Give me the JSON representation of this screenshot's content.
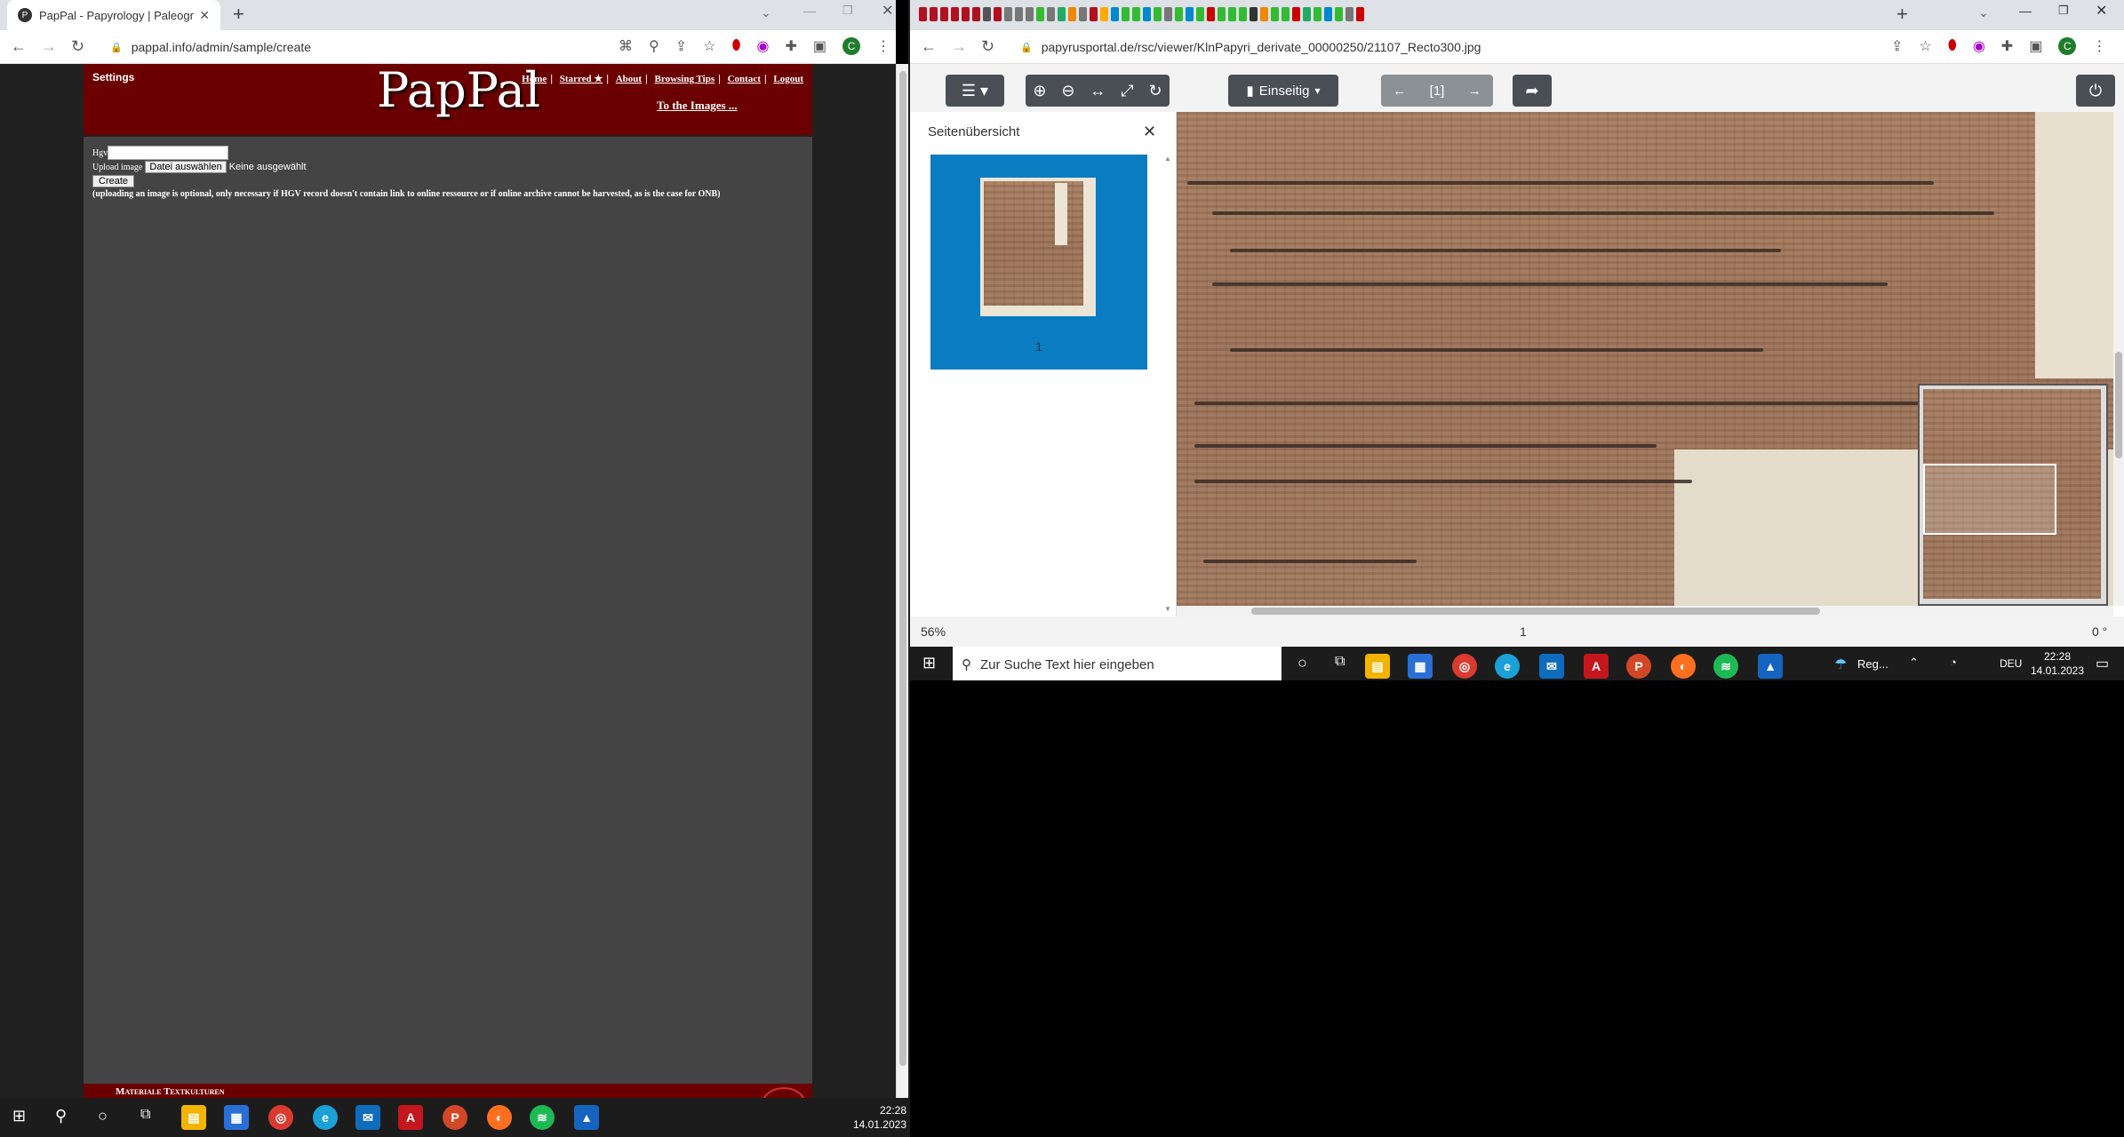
{
  "left_browser": {
    "tab_title": "PapPal - Papyrology | Paleograph",
    "url": "pappal.info/admin/sample/create"
  },
  "right_browser": {
    "url": "papyrusportal.de/rsc/viewer/KlnPapyri_derivate_00000250/21107_Recto300.jpg"
  },
  "pappal": {
    "settings": "Settings",
    "logo": "PapPal",
    "nav": [
      "Home",
      "Starred ★",
      "About",
      "Browsing Tips",
      "Contact",
      "Logout"
    ],
    "to_images": "To the Images ...",
    "hgv_label": "Hgv",
    "hgv_value": "",
    "upload_label": "Upload image",
    "file_button": "Datei auswählen",
    "file_status": "Keine ausgewählt",
    "create_button": "Create",
    "note": "(uploading an image is optional, only necessary if HGV record doesn't contain link to online ressource or if online archive cannot be harvested, as is the case for ONB)",
    "footer": "Materiale Textkulturen"
  },
  "viewer": {
    "mode": "Einseitig",
    "page_indicator": "[1]",
    "sidebar_title": "Seitenübersicht",
    "thumb_label": "1",
    "zoom": "56%",
    "page": "1",
    "rotation": "0 °"
  },
  "taskbar": {
    "search_placeholder": "Zur Suche Text hier eingeben",
    "left_time": "22:28",
    "left_date": "14.01.2023",
    "weather": "Reg...",
    "lang": "DEU",
    "right_time": "22:28",
    "right_date": "14.01.2023"
  }
}
